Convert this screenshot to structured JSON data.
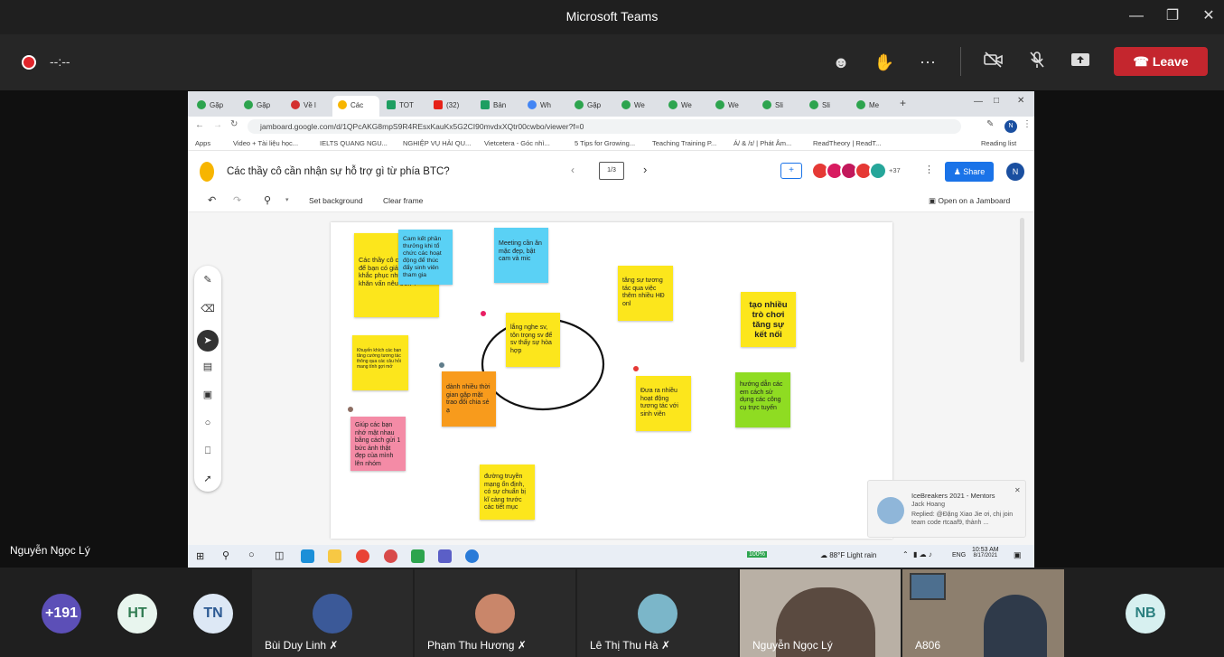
{
  "titlebar": {
    "title": "Microsoft Teams"
  },
  "meeting": {
    "timer": "--:--",
    "leave_label": "Leave"
  },
  "browser": {
    "tabs": [
      {
        "label": "Gặp"
      },
      {
        "label": "Gặp"
      },
      {
        "label": "Về l"
      },
      {
        "label": "Các",
        "active": true
      },
      {
        "label": "TOT"
      },
      {
        "label": "(32)"
      },
      {
        "label": "Bản"
      },
      {
        "label": "Wh"
      },
      {
        "label": "Gặp"
      },
      {
        "label": "We"
      },
      {
        "label": "We"
      },
      {
        "label": "We"
      },
      {
        "label": "Sli"
      },
      {
        "label": "Sli"
      },
      {
        "label": "Me"
      }
    ],
    "url": "jamboard.google.com/d/1QPcAKG8mpS9R4REsxKauKx5G2CI90mvdxXQtr00cwbo/viewer?f=0",
    "bookmarks": [
      "Apps",
      "Video + Tài liệu học...",
      "IELTS QUANG NGU...",
      "NGHIỆP VỤ HẢI QU...",
      "Vietcetera - Góc nhì...",
      "5 Tips for Growing...",
      "Teaching Training P...",
      "Á/ & /ɪ/ | Phát Âm...",
      "ReadTheory | ReadT...",
      "Reading list"
    ]
  },
  "jamboard": {
    "title": "Các thầy cô cần nhận sự hỗ trợ gì từ phía BTC?",
    "pager": "1/3",
    "extra_count": "+37",
    "share_label": "Share",
    "user_initial": "N",
    "set_background": "Set background",
    "clear_frame": "Clear frame",
    "open_on": "Open on a Jamboard",
    "notes": [
      {
        "text": "Các thầy cô cần hỗ trợ gì để bạn có giải pháp để khắc phục những khó khăn vấn nêu trên ?",
        "color": "yellow"
      },
      {
        "text": "Cam kết phần thưởng khi tổ chức các hoạt động để thúc đẩy sinh viên tham gia",
        "color": "blue"
      },
      {
        "text": "Meeting cần ăn mặc đẹp, bật cam và mic",
        "color": "blue"
      },
      {
        "text": "tăng sự tương tác qua việc thêm nhiều HĐ onl",
        "color": "yellow"
      },
      {
        "text": "tạo nhiều trò chơi tăng sự kết nối",
        "color": "yellow"
      },
      {
        "text": "lắng nghe sv, tôn trọng sv để sv thấy sự hòa hợp",
        "color": "yellow"
      },
      {
        "text": "Khuyến khích các bạn tăng cường tương tác thông qua các câu hỏi mang tính gợi mở",
        "color": "yellow"
      },
      {
        "text": "dành nhiều thời gian gặp mặt trao đổi chia sẻ ạ",
        "color": "orange"
      },
      {
        "text": "Đưa ra nhiều hoạt động tương tác với sinh viên",
        "color": "yellow"
      },
      {
        "text": "hướng dẫn các em cách sử dụng các công cụ trực tuyến",
        "color": "green"
      },
      {
        "text": "Giúp các bạn nhớ mặt nhau bằng cách gửi 1 bức ảnh thật đẹp của mình lên nhóm",
        "color": "pink"
      },
      {
        "text": "đường truyền mạng ổn định, có sự chuẩn bị kĩ càng trước các tiết mục",
        "color": "yellow"
      }
    ]
  },
  "toast": {
    "title": "IceBreakers 2021 - Mentors",
    "sender": "Jack Hoang",
    "message": "Replied: @Đặng Xiao Jie ơi, chị join team code rtcaaf9, thành ..."
  },
  "taskbar": {
    "battery": "100%",
    "weather": "88°F Light rain",
    "lang": "ENG",
    "time": "10:53 AM",
    "date": "8/17/2021"
  },
  "presenter_name": "Nguyễn Ngọc Lý",
  "participants": {
    "overflow": "+191",
    "initials": [
      {
        "text": "HT",
        "color": "#e8f5ee"
      },
      {
        "text": "TN",
        "color": "#dde8f5"
      },
      {
        "text": "NB",
        "color": "#d7f0f0"
      }
    ],
    "tiles": [
      {
        "name": "Bùi Duy Linh"
      },
      {
        "name": "Phạm Thu Hương"
      },
      {
        "name": "Lê Thị Thu Hà"
      },
      {
        "name": "Nguyễn Ngọc Lý"
      },
      {
        "name": "A806"
      }
    ]
  }
}
